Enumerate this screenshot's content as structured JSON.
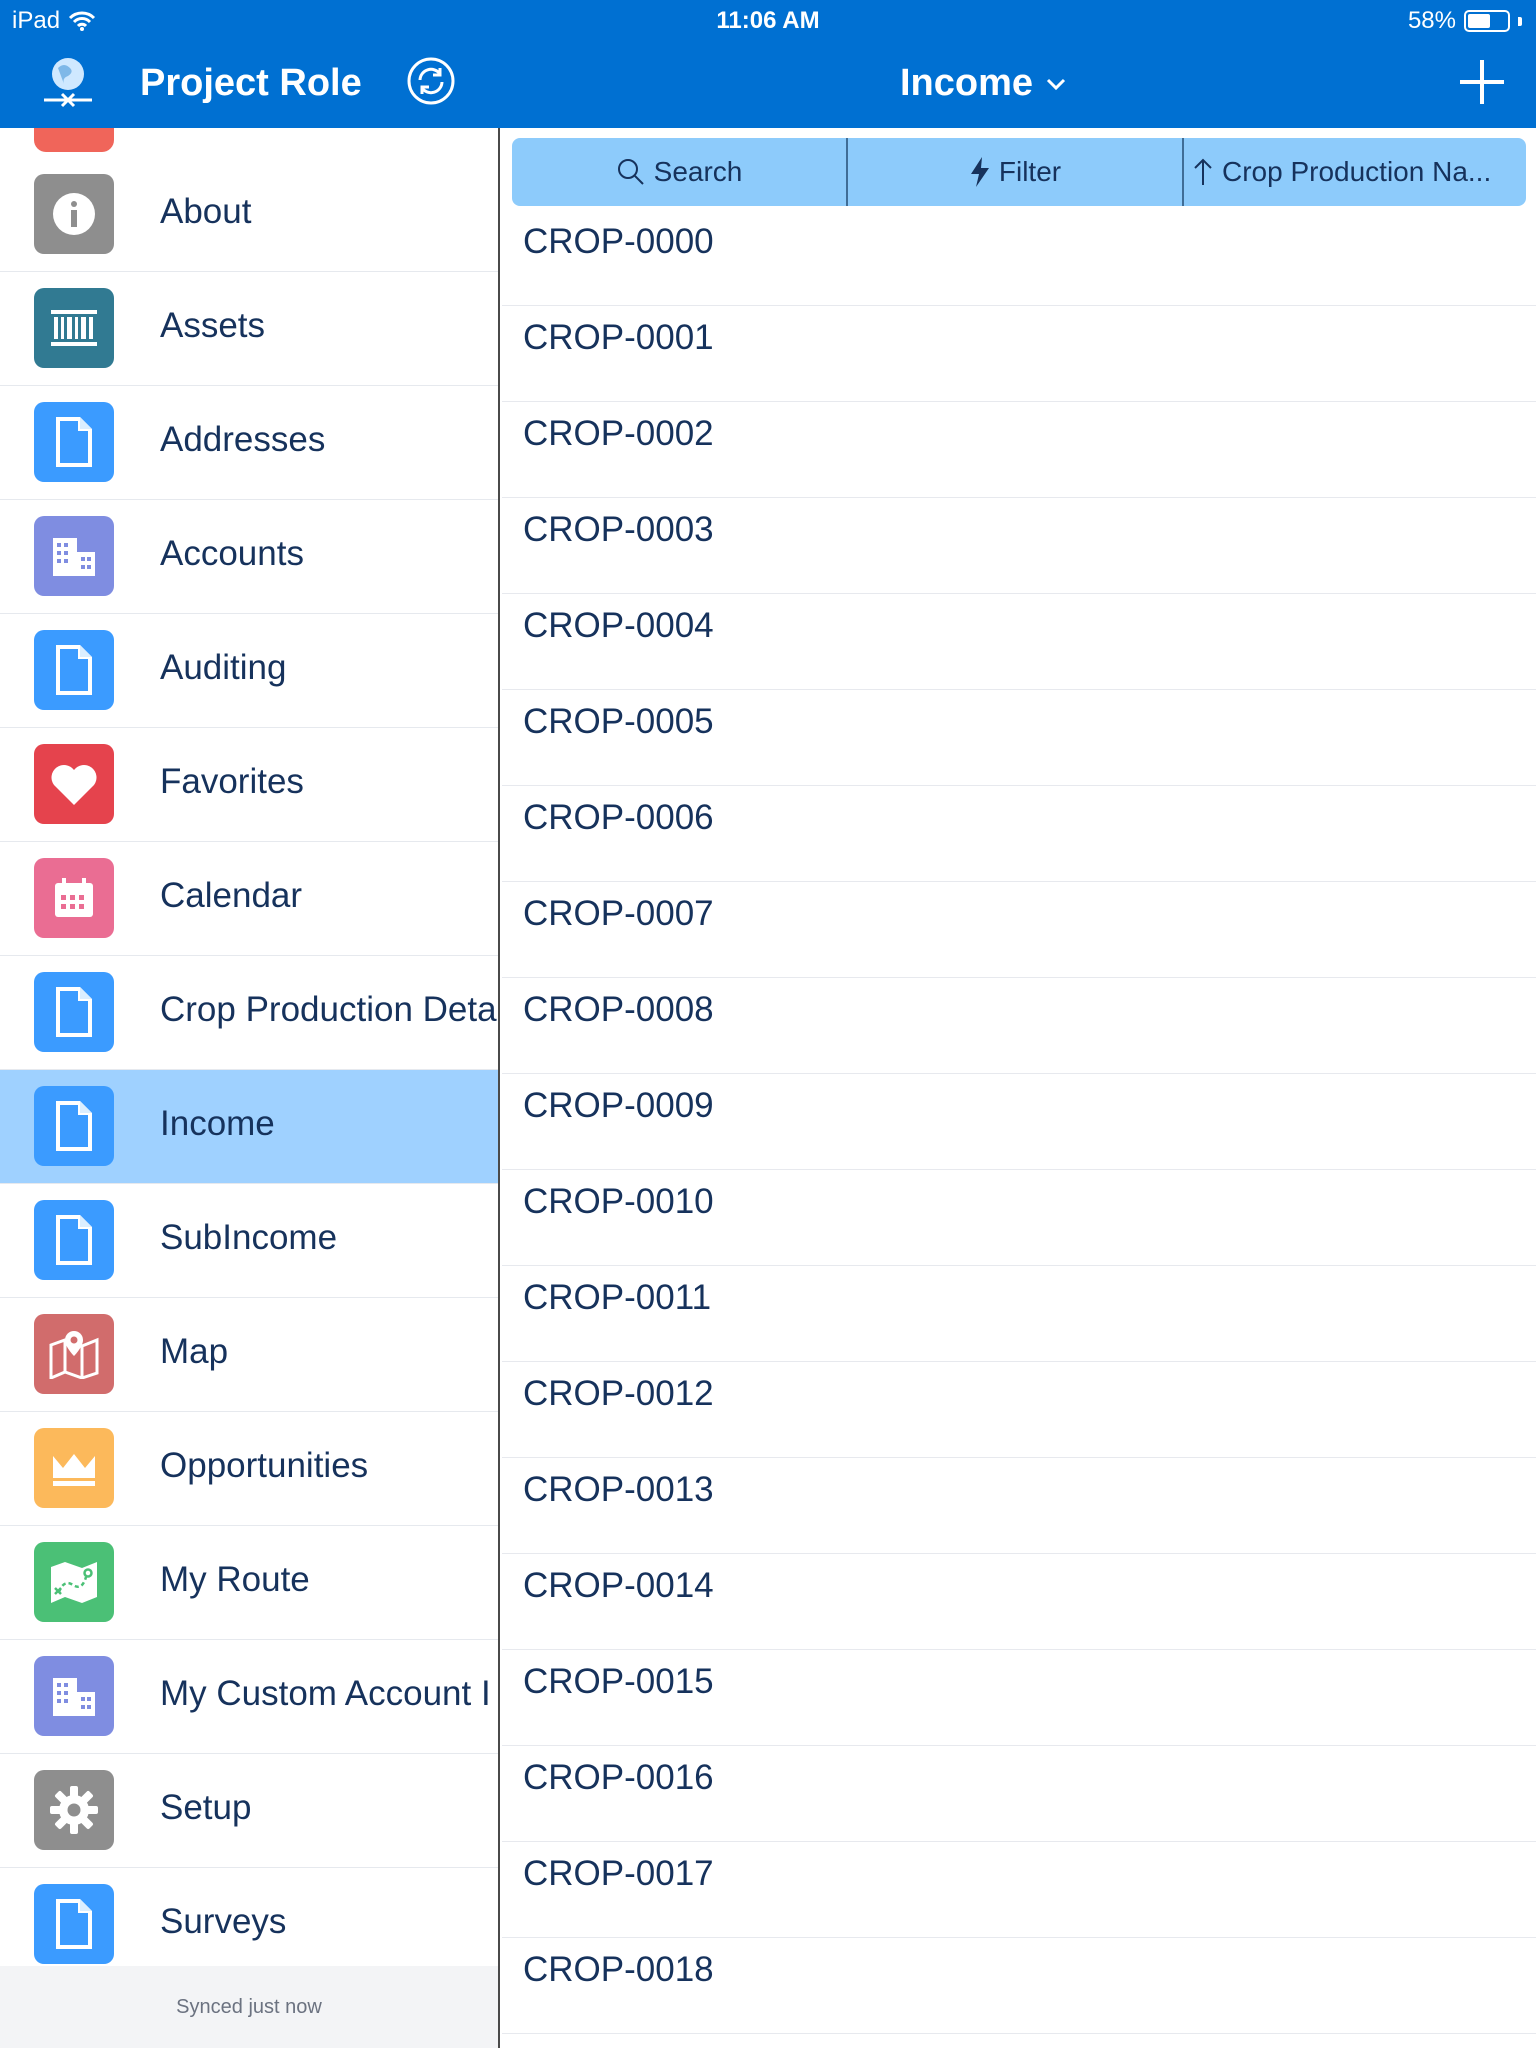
{
  "status_bar": {
    "carrier": "iPad",
    "time": "11:06 AM",
    "battery": "58%",
    "battery_level": 0.58
  },
  "header": {
    "app_title": "Project Role",
    "current_object": "Income",
    "icons": {
      "logo": "globe-logo-icon",
      "sync": "sync-icon",
      "dropdown": "chevron-down-icon",
      "add": "plus-icon"
    }
  },
  "sidebar": {
    "items": [
      {
        "label": "About",
        "icon": "info-icon",
        "color": "#8e8e8e"
      },
      {
        "label": "Assets",
        "icon": "barcode-icon",
        "color": "#317a92"
      },
      {
        "label": "Addresses",
        "icon": "document-icon",
        "color": "#3b9bff"
      },
      {
        "label": "Accounts",
        "icon": "building-icon",
        "color": "#7f8de1"
      },
      {
        "label": "Auditing",
        "icon": "document-icon",
        "color": "#3b9bff"
      },
      {
        "label": "Favorites",
        "icon": "heart-icon",
        "color": "#e5434d"
      },
      {
        "label": "Calendar",
        "icon": "calendar-icon",
        "color": "#ea6d93"
      },
      {
        "label": "Crop Production Deta",
        "icon": "document-icon",
        "color": "#3b9bff"
      },
      {
        "label": "Income",
        "icon": "document-icon",
        "color": "#3b9bff",
        "selected": true
      },
      {
        "label": "SubIncome",
        "icon": "document-icon",
        "color": "#3b9bff"
      },
      {
        "label": "Map",
        "icon": "map-icon",
        "color": "#d16c6c"
      },
      {
        "label": "Opportunities",
        "icon": "crown-icon",
        "color": "#fcb95b"
      },
      {
        "label": "My Route",
        "icon": "route-icon",
        "color": "#4bc076"
      },
      {
        "label": "My Custom Account I",
        "icon": "building-icon",
        "color": "#7f8de1"
      },
      {
        "label": "Setup",
        "icon": "gear-icon",
        "color": "#8e8e8e"
      },
      {
        "label": "Surveys",
        "icon": "document-icon",
        "color": "#3b9bff"
      }
    ],
    "footer": "Synced just now"
  },
  "toolbar": {
    "search": "Search",
    "filter": "Filter",
    "sort": "Crop Production Na..."
  },
  "records": [
    "CROP-0000",
    "CROP-0001",
    "CROP-0002",
    "CROP-0003",
    "CROP-0004",
    "CROP-0005",
    "CROP-0006",
    "CROP-0007",
    "CROP-0008",
    "CROP-0009",
    "CROP-0010",
    "CROP-0011",
    "CROP-0012",
    "CROP-0013",
    "CROP-0014",
    "CROP-0015",
    "CROP-0016",
    "CROP-0017",
    "CROP-0018"
  ]
}
